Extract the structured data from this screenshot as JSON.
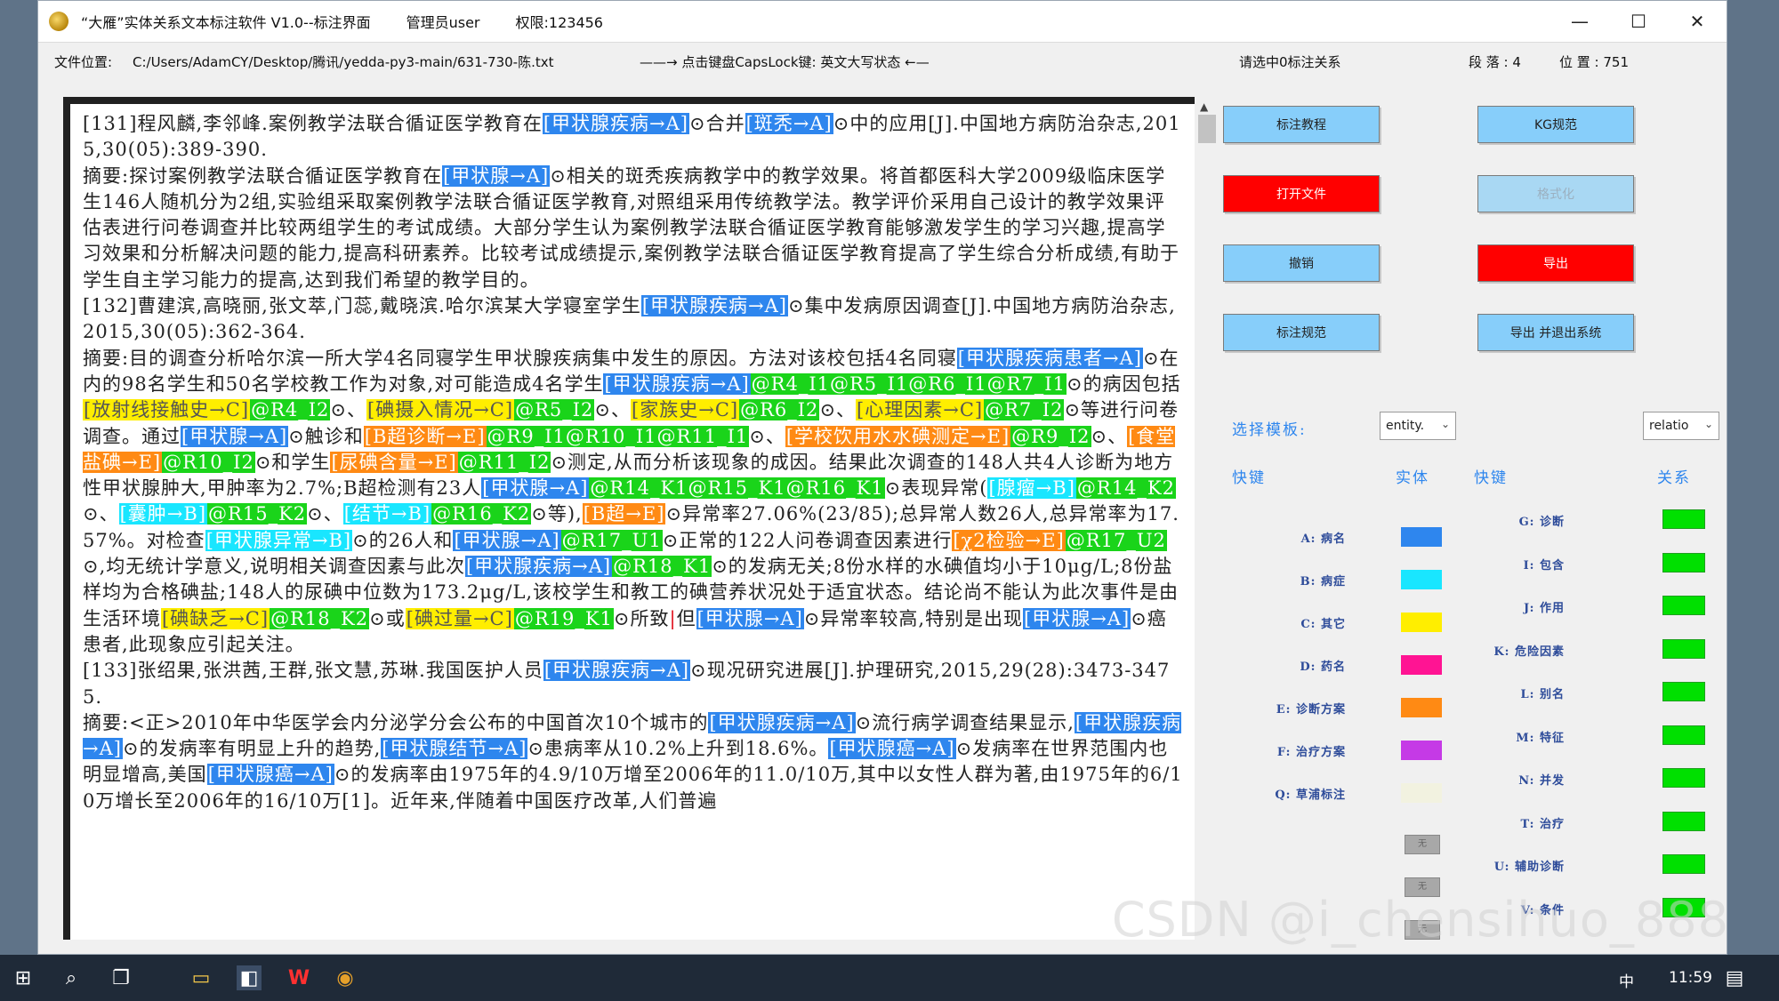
{
  "window": {
    "title": "“大雁”实体关系文本标注软件 V1.0--标注界面",
    "admin": "管理员user",
    "permission": "权限:123456",
    "controls": {
      "minimize": "—",
      "maximize": "☐",
      "close": "✕"
    }
  },
  "info": {
    "file_label": "文件位置:",
    "file_path": "C:/Users/AdamCY/Desktop/腾讯/yedda-py3-main/631-730-陈.txt",
    "capslock_hint": "——→ 点击键盘CapsLock键: 英文大写状态 ←—",
    "select_relation": "请选中0标注关系",
    "lines": "段 落 : 4",
    "position": "位 置 : 751"
  },
  "text_panel": {
    "segments": [
      {
        "t": "[131]程风麟,李邻峰.案例教学法联合循证医学教育在"
      },
      {
        "t": "[甲状腺疾病→A]",
        "c": "blue"
      },
      {
        "t": "⊙合并"
      },
      {
        "t": "[斑秃→A]",
        "c": "blue"
      },
      {
        "t": "⊙中的应用[J].中国地方病防治杂志,2015,30(05):389-390.\n"
      },
      {
        "t": "摘要:探讨案例教学法联合循证医学教育在"
      },
      {
        "t": "[甲状腺→A]",
        "c": "blue"
      },
      {
        "t": "⊙相关的斑秃疾病教学中的教学效果。将首都医科大学2009级临床医学生146人随机分为2组,实验组采取案例教学法联合循证医学教育,对照组采用传统教学法。教学评价采用自己设计的教学效果评估表进行问卷调查并比较两组学生的考试成绩。大部分学生认为案例教学法联合循证医学教育能够激发学生的学习兴趣,提高学习效果和分析解决问题的能力,提高科研素养。比较考试成绩提示,案例教学法联合循证医学教育提高了学生综合分析成绩,有助于学生自主学习能力的提高,达到我们希望的教学目的。\n"
      },
      {
        "t": "[132]曹建滨,高晓丽,张文萃,门蕊,戴晓滨.哈尔滨某大学寝室学生"
      },
      {
        "t": "[甲状腺疾病→A]",
        "c": "blue"
      },
      {
        "t": "⊙集中发病原因调查[J].中国地方病防治杂志,2015,30(05):362-364.\n"
      },
      {
        "t": "摘要:目的调查分析哈尔滨一所大学4名同寝学生甲状腺疾病集中发生的原因。方法对该校包括4名同寝"
      },
      {
        "t": "[甲状腺疾病患者→A]",
        "c": "blue"
      },
      {
        "t": "⊙在内的98名学生和50名学校教工作为对象,对可能造成4名学生"
      },
      {
        "t": "[甲状腺疾病→A]",
        "c": "blue"
      },
      {
        "t": "@R4_I1@R5_I1@R6_I1@R7_I1",
        "c": "green"
      },
      {
        "t": "⊙的病因包括"
      },
      {
        "t": "[放射线接触史→C]",
        "c": "yellow"
      },
      {
        "t": "@R4_I2",
        "c": "green"
      },
      {
        "t": "⊙、"
      },
      {
        "t": "[碘摄入情况→C]",
        "c": "yellow"
      },
      {
        "t": "@R5_I2",
        "c": "green"
      },
      {
        "t": "⊙、"
      },
      {
        "t": "[家族史→C]",
        "c": "yellow"
      },
      {
        "t": "@R6_I2",
        "c": "green"
      },
      {
        "t": "⊙、"
      },
      {
        "t": "[心理因素→C]",
        "c": "yellow"
      },
      {
        "t": "@R7_I2",
        "c": "green"
      },
      {
        "t": "⊙等进行问卷调查。通过"
      },
      {
        "t": "[甲状腺→A]",
        "c": "blue"
      },
      {
        "t": "⊙触诊和"
      },
      {
        "t": "[B超诊断→E]",
        "c": "orange"
      },
      {
        "t": "@R9_I1@R10_I1@R11_I1",
        "c": "green"
      },
      {
        "t": "⊙、"
      },
      {
        "t": "[学校饮用水水碘测定→E]",
        "c": "orange"
      },
      {
        "t": "@R9_I2",
        "c": "green"
      },
      {
        "t": "⊙、"
      },
      {
        "t": "[食堂盐碘→E]",
        "c": "orange"
      },
      {
        "t": "@R10_I2",
        "c": "green"
      },
      {
        "t": "⊙和学生"
      },
      {
        "t": "[尿碘含量→E]",
        "c": "orange"
      },
      {
        "t": "@R11_I2",
        "c": "green"
      },
      {
        "t": "⊙测定,从而分析该现象的成因。结果此次调查的148人共4人诊断为地方性甲状腺肿大,甲肿率为2.7%;B超检测有23人"
      },
      {
        "t": "[甲状腺→A]",
        "c": "blue"
      },
      {
        "t": "@R14_K1@R15_K1@R16_K1",
        "c": "green"
      },
      {
        "t": "⊙表现异常("
      },
      {
        "t": "[腺瘤→B]",
        "c": "cyan"
      },
      {
        "t": "@R14_K2",
        "c": "green"
      },
      {
        "t": "⊙、"
      },
      {
        "t": "[囊肿→B]",
        "c": "cyan"
      },
      {
        "t": "@R15_K2",
        "c": "green"
      },
      {
        "t": "⊙、"
      },
      {
        "t": "[结节→B]",
        "c": "cyan"
      },
      {
        "t": "@R16_K2",
        "c": "green"
      },
      {
        "t": "⊙等),"
      },
      {
        "t": "[B超→E]",
        "c": "orange"
      },
      {
        "t": "⊙异常率27.06%(23/85);总异常人数26人,总异常率为17.57%。对检查"
      },
      {
        "t": "[甲状腺异常→B]",
        "c": "cyan"
      },
      {
        "t": "⊙的26人和"
      },
      {
        "t": "[甲状腺→A]",
        "c": "blue"
      },
      {
        "t": "@R17_U1",
        "c": "green"
      },
      {
        "t": "⊙正常的122人问卷调查因素进行"
      },
      {
        "t": "[χ2检验→E]",
        "c": "orange"
      },
      {
        "t": "@R17_U2",
        "c": "green"
      },
      {
        "t": "⊙,均无统计学意义,说明相关调查因素与此次"
      },
      {
        "t": "[甲状腺疾病→A]",
        "c": "blue"
      },
      {
        "t": "@R18_K1",
        "c": "green"
      },
      {
        "t": "⊙的发病无关;8份水样的水碘值均小于10μg/L;8份盐样均为合格碘盐;148人的尿碘中位数为173.2μg/L,该校学生和教工的碘营养状况处于适宜状态。结论尚不能认为此次事件是由生活环境"
      },
      {
        "t": "[碘缺乏→C]",
        "c": "yellow"
      },
      {
        "t": "@R18_K2",
        "c": "green"
      },
      {
        "t": "⊙或"
      },
      {
        "t": "[碘过量→C]",
        "c": "yellow"
      },
      {
        "t": "@R19_K1",
        "c": "green"
      },
      {
        "t": "⊙所致"
      },
      {
        "t": "|",
        "c": "cursor"
      },
      {
        "t": "但"
      },
      {
        "t": "[甲状腺→A]",
        "c": "blue"
      },
      {
        "t": "⊙异常率较高,特别是出现"
      },
      {
        "t": "[甲状腺→A]",
        "c": "blue"
      },
      {
        "t": "⊙癌患者,此现象应引起关注。\n"
      },
      {
        "t": "[133]张绍果,张洪茜,王群,张文慧,苏琳.我国医护人员"
      },
      {
        "t": "[甲状腺疾病→A]",
        "c": "blue"
      },
      {
        "t": "⊙现况研究进展[J].护理研究,2015,29(28):3473-3475.\n"
      },
      {
        "t": "摘要:<正>2010年中华医学会内分泌学分会公布的中国首次10个城市的"
      },
      {
        "t": "[甲状腺疾病→A]",
        "c": "blue"
      },
      {
        "t": "⊙流行病学调查结果显示,"
      },
      {
        "t": "[甲状腺疾病→A]",
        "c": "blue"
      },
      {
        "t": "⊙的发病率有明显上升的趋势,"
      },
      {
        "t": "[甲状腺结节→A]",
        "c": "blue"
      },
      {
        "t": "⊙患病率从10.2%上升到18.6%。"
      },
      {
        "t": "[甲状腺癌→A]",
        "c": "blue"
      },
      {
        "t": "⊙发病率在世界范围内也明显增高,美国"
      },
      {
        "t": "[甲状腺癌→A]",
        "c": "blue"
      },
      {
        "t": "⊙的发病率由1975年的4.9/10万增至2006年的11.0/10万,其中以女性人群为著,由1975年的6/10万增长至2006年的16/10万[1]。近年来,伴随着中国医疗改革,人们普遍"
      }
    ]
  },
  "buttons": {
    "tutorial": "标注教程",
    "kg": "KG规范",
    "open_file": "打开文件",
    "format": "格式化",
    "undo": "撤销",
    "export": "导出",
    "spec": "标注规范",
    "export_exit": "导出 并退出系统"
  },
  "templates": {
    "label": "选择模板:",
    "entity_value": "entity.",
    "relation_value": "relatio"
  },
  "headers": {
    "hotkey_left": "快键",
    "entity": "实体",
    "hotkey_right": "快键",
    "relation": "关系"
  },
  "entity_hotkeys": [
    {
      "label": "A: 病名",
      "color": "#2e86ee"
    },
    {
      "label": "B: 病症",
      "color": "#19e6ff"
    },
    {
      "label": "C: 其它",
      "color": "#ffee00"
    },
    {
      "label": "D: 药名",
      "color": "#ff1493"
    },
    {
      "label": "E: 诊断方案",
      "color": "#ff8a14"
    },
    {
      "label": "F: 治疗方案",
      "color": "#c53ae6"
    },
    {
      "label": "Q: 草浦标注",
      "color": "#f2f2e0"
    }
  ],
  "gray_keys": [
    "无",
    "无",
    "无"
  ],
  "relation_hotkeys": [
    {
      "label": "G: 诊断"
    },
    {
      "label": "I: 包含"
    },
    {
      "label": "J: 作用"
    },
    {
      "label": "K: 危险因素"
    },
    {
      "label": "L: 别名"
    },
    {
      "label": "M: 特征"
    },
    {
      "label": "N: 并发"
    },
    {
      "label": "T: 治疗"
    },
    {
      "label": "U: 辅助诊断"
    },
    {
      "label": "V: 条件"
    }
  ],
  "watermark": "CSDN @i_chensihuo_888",
  "taskbar": {
    "ime": "中",
    "time": "11:59"
  }
}
